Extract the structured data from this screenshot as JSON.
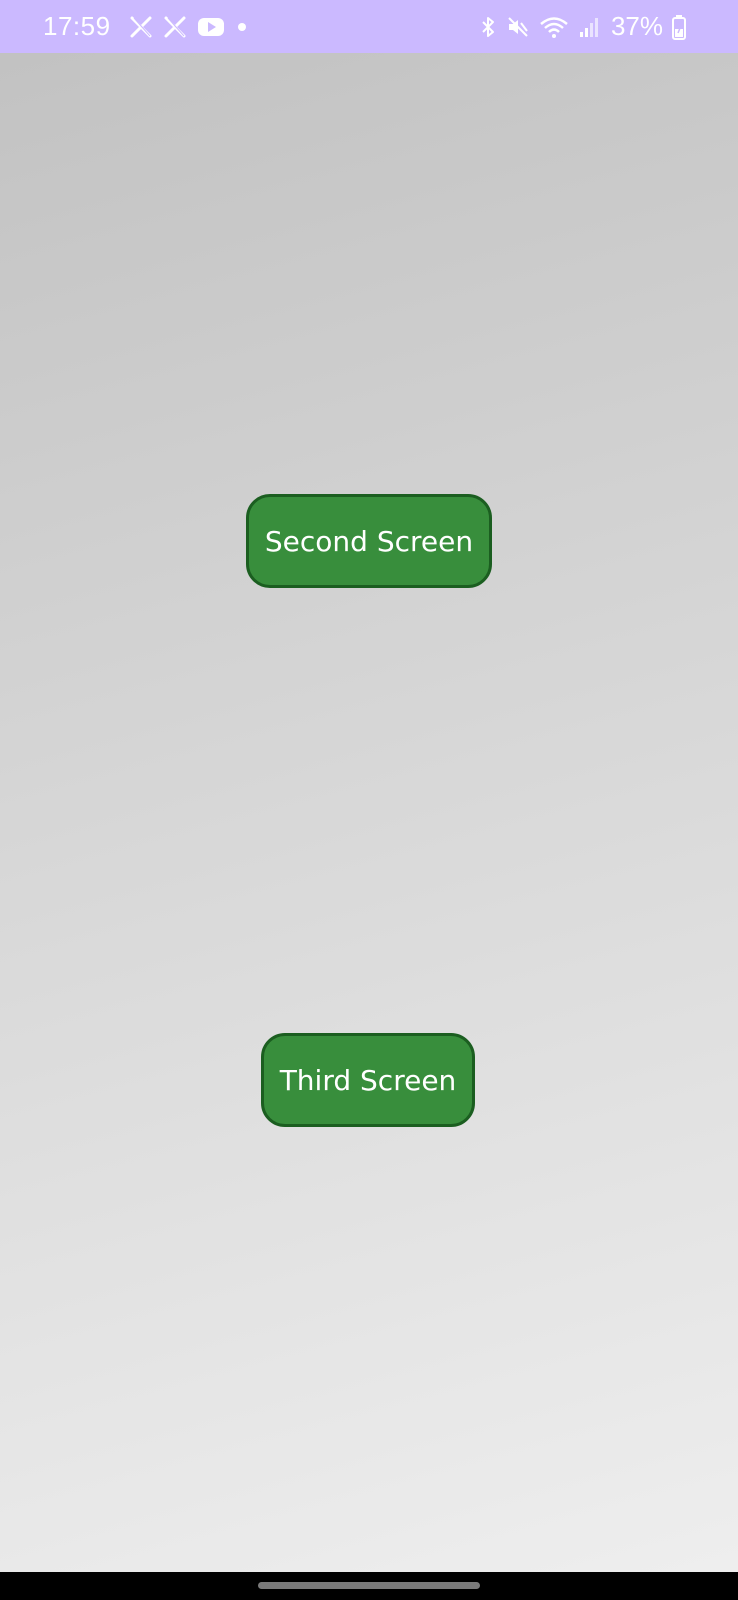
{
  "status_bar": {
    "time": "17:59",
    "left_icons": [
      "x-logo-icon",
      "x-logo-icon",
      "youtube-icon",
      "notification-dot-icon"
    ],
    "right_icons": [
      "bluetooth-icon",
      "mute-vibrate-icon",
      "wifi-icon",
      "signal-icon"
    ],
    "battery_percent": "37%",
    "background_color": "#cbb9ff"
  },
  "main": {
    "buttons": [
      {
        "label": "Second Screen"
      },
      {
        "label": "Third Screen"
      }
    ],
    "button_color": "#388e3c",
    "button_border_color": "#1b5e20"
  },
  "nav_bar": {
    "background_color": "#000000"
  }
}
